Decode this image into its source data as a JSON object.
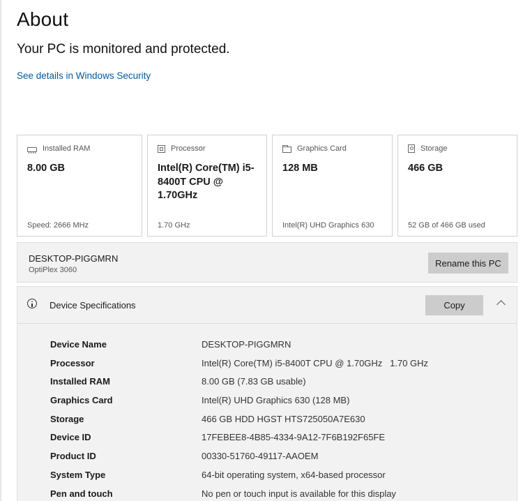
{
  "title": "About",
  "status": "Your PC is monitored and protected.",
  "security_link": "See details in Windows Security",
  "cards": [
    {
      "icon": "memory-icon",
      "label": "Installed RAM",
      "value": "8.00 GB",
      "sub": "Speed: 2666 MHz"
    },
    {
      "icon": "processor-icon",
      "label": "Processor",
      "value": "Intel(R) Core(TM) i5-8400T CPU @ 1.70GHz",
      "sub": "1.70 GHz"
    },
    {
      "icon": "graphics-card-icon",
      "label": "Graphics Card",
      "value": "128 MB",
      "sub": "Intel(R) UHD Graphics 630"
    },
    {
      "icon": "storage-icon",
      "label": "Storage",
      "value": "466 GB",
      "sub": "52 GB of 466 GB used"
    }
  ],
  "pc": {
    "name": "DESKTOP-PIGGMRN",
    "model": "OptiPlex 3060",
    "rename_label": "Rename this PC"
  },
  "specs": {
    "title": "Device Specifications",
    "copy_label": "Copy",
    "rows": [
      {
        "label": "Device Name",
        "value": "DESKTOP-PIGGMRN"
      },
      {
        "label": "Processor",
        "value": "Intel(R) Core(TM) i5-8400T CPU @ 1.70GHz   1.70 GHz"
      },
      {
        "label": "Installed RAM",
        "value": "8.00 GB (7.83 GB usable)"
      },
      {
        "label": "Graphics Card",
        "value": "Intel(R) UHD Graphics 630 (128 MB)"
      },
      {
        "label": "Storage",
        "value": "466 GB HDD HGST HTS725050A7E630"
      },
      {
        "label": "Device ID",
        "value": "17FEBEE8-4B85-4334-9A12-7F6B192F65FE"
      },
      {
        "label": "Product ID",
        "value": "00330-51760-49117-AAOEM"
      },
      {
        "label": "System Type",
        "value": "64-bit operating system, x64-based processor"
      },
      {
        "label": "Pen and touch",
        "value": "No pen or touch input is available for this display"
      }
    ]
  }
}
